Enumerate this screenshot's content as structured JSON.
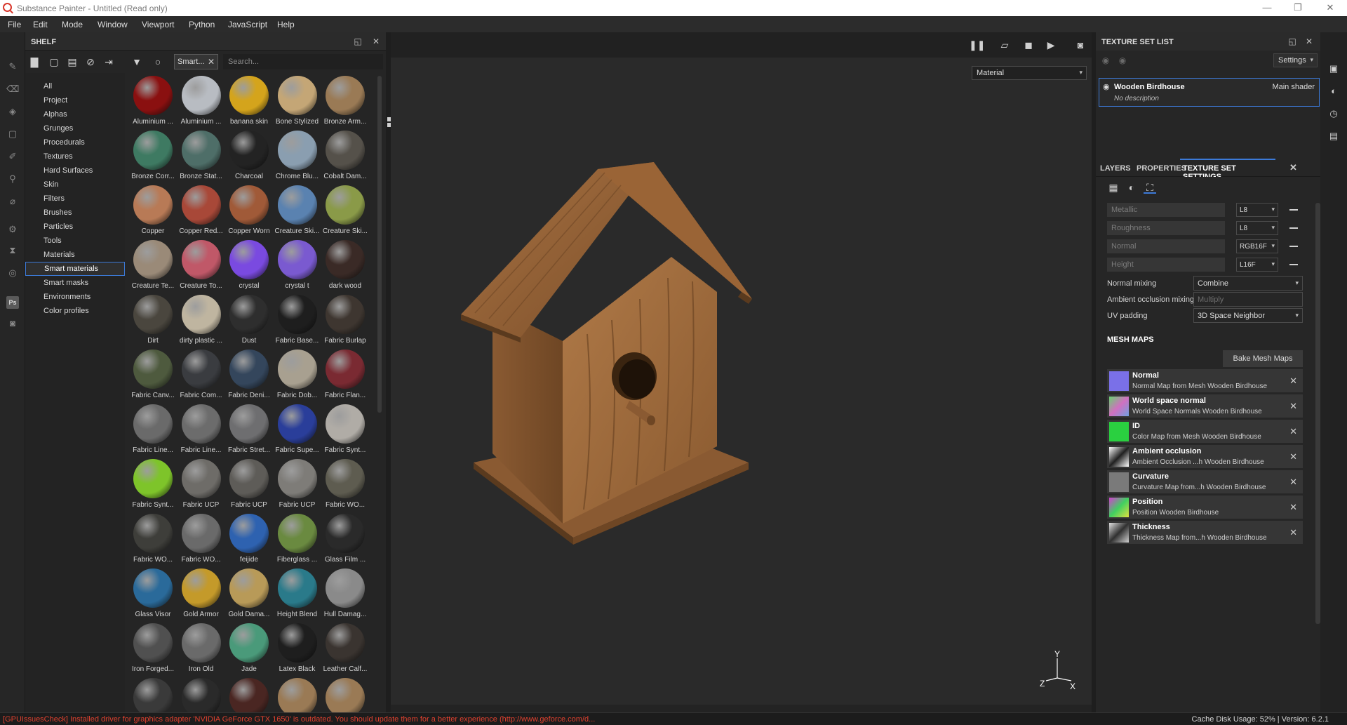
{
  "window": {
    "title": "Substance Painter - Untitled (Read only)"
  },
  "menu": [
    "File",
    "Edit",
    "Mode",
    "Window",
    "Viewport",
    "Python",
    "JavaScript",
    "Help"
  ],
  "shelf": {
    "title": "SHELF",
    "filter_chip": "Smart...",
    "search_placeholder": "Search...",
    "categories": [
      "All",
      "Project",
      "Alphas",
      "Grunges",
      "Procedurals",
      "Textures",
      "Hard Surfaces",
      "Skin",
      "Filters",
      "Brushes",
      "Particles",
      "Tools",
      "Materials",
      "Smart materials",
      "Smart masks",
      "Environments",
      "Color profiles"
    ],
    "active_category": "Smart materials",
    "materials": [
      {
        "label": "Aluminium ...",
        "color": "#8a1010"
      },
      {
        "label": "Aluminium ...",
        "color": "#b8bcc2"
      },
      {
        "label": "banana skin",
        "color": "#d4a41c"
      },
      {
        "label": "Bone Stylized",
        "color": "#c4a676"
      },
      {
        "label": "Bronze Arm...",
        "color": "#9a7a55"
      },
      {
        "label": "Bronze Corr...",
        "color": "#3e7a62"
      },
      {
        "label": "Bronze Stat...",
        "color": "#4e6e68"
      },
      {
        "label": "Charcoal",
        "color": "#232323"
      },
      {
        "label": "Chrome Blu...",
        "color": "#8a9eb0"
      },
      {
        "label": "Cobalt Dam...",
        "color": "#55514a"
      },
      {
        "label": "Copper",
        "color": "#b87a56"
      },
      {
        "label": "Copper Red...",
        "color": "#a84838"
      },
      {
        "label": "Copper Worn",
        "color": "#a05a38"
      },
      {
        "label": "Creature Ski...",
        "color": "#5a82b0"
      },
      {
        "label": "Creature Ski...",
        "color": "#8a9a48"
      },
      {
        "label": "Creature Te...",
        "color": "#9a8a78"
      },
      {
        "label": "Creature To...",
        "color": "#c05868"
      },
      {
        "label": "crystal",
        "color": "#7a4ae0"
      },
      {
        "label": "crystal t",
        "color": "#7a5ad0"
      },
      {
        "label": "dark wood",
        "color": "#3a2a26"
      },
      {
        "label": "Dirt",
        "color": "#4a463e"
      },
      {
        "label": "dirty plastic ...",
        "color": "#bfb5a0"
      },
      {
        "label": "Dust",
        "color": "#2e2e2e"
      },
      {
        "label": "Fabric Base...",
        "color": "#1e1e1e"
      },
      {
        "label": "Fabric Burlap",
        "color": "#3e3630"
      },
      {
        "label": "Fabric Canv...",
        "color": "#4e5a3e"
      },
      {
        "label": "Fabric Com...",
        "color": "#3a3c40"
      },
      {
        "label": "Fabric Deni...",
        "color": "#34465c"
      },
      {
        "label": "Fabric Dob...",
        "color": "#a8a090"
      },
      {
        "label": "Fabric Flan...",
        "color": "#7a2a32"
      },
      {
        "label": "Fabric Line...",
        "color": "#6a6a6a"
      },
      {
        "label": "Fabric Line...",
        "color": "#6c6c6c"
      },
      {
        "label": "Fabric Stret...",
        "color": "#6e6e70"
      },
      {
        "label": "Fabric Supe...",
        "color": "#2a3e9a"
      },
      {
        "label": "Fabric Synt...",
        "color": "#b0aca6"
      },
      {
        "label": "Fabric Synt...",
        "color": "#7ec42a"
      },
      {
        "label": "Fabric UCP",
        "color": "#6e6c68"
      },
      {
        "label": "Fabric UCP",
        "color": "#5e5c58"
      },
      {
        "label": "Fabric UCP",
        "color": "#7e7c78"
      },
      {
        "label": "Fabric WO...",
        "color": "#5e5c50"
      },
      {
        "label": "Fabric WO...",
        "color": "#3e3e3a"
      },
      {
        "label": "Fabric WO...",
        "color": "#6a6a6a"
      },
      {
        "label": "feijide",
        "color": "#2e62b0"
      },
      {
        "label": "Fiberglass ...",
        "color": "#6a8a40"
      },
      {
        "label": "Glass Film ...",
        "color": "#2a2a2a"
      },
      {
        "label": "Glass Visor",
        "color": "#2a6a9a"
      },
      {
        "label": "Gold Armor",
        "color": "#c49a2a"
      },
      {
        "label": "Gold Dama...",
        "color": "#b89a58"
      },
      {
        "label": "Height Blend",
        "color": "#2a7a8a"
      },
      {
        "label": "Hull Damag...",
        "color": "#8a8a8a"
      },
      {
        "label": "Iron Forged...",
        "color": "#505050"
      },
      {
        "label": "Iron Old",
        "color": "#6a6a6a"
      },
      {
        "label": "Jade",
        "color": "#4a9a7a"
      },
      {
        "label": "Latex Black",
        "color": "#1e1e1e"
      },
      {
        "label": "Leather Calf...",
        "color": "#3a3430"
      },
      {
        "label": "",
        "color": "#3a3a3a"
      },
      {
        "label": "",
        "color": "#2a2a2a"
      },
      {
        "label": "",
        "color": "#4a2622"
      },
      {
        "label": "",
        "color": "#9a7a55"
      },
      {
        "label": "",
        "color": "#9a7a55"
      }
    ]
  },
  "viewport": {
    "mode_select": "Material",
    "gizmo": {
      "y": "Y",
      "z": "Z",
      "x": "X"
    }
  },
  "texture_set_list": {
    "title": "TEXTURE SET LIST",
    "settings_label": "Settings",
    "item": {
      "name": "Wooden Birdhouse",
      "shader": "Main shader",
      "description": "No description"
    }
  },
  "tabs": {
    "layers": "LAYERS",
    "properties": "PROPERTIES",
    "texture_set_settings": "TEXTURE SET SETTINGS"
  },
  "texture_set_settings": {
    "channels": [
      {
        "name": "Metallic",
        "format": "L8"
      },
      {
        "name": "Roughness",
        "format": "L8"
      },
      {
        "name": "Normal",
        "format": "RGB16F"
      },
      {
        "name": "Height",
        "format": "L16F"
      }
    ],
    "normal_mixing": {
      "label": "Normal mixing",
      "value": "Combine"
    },
    "ao_mixing": {
      "label": "Ambient occlusion mixing",
      "value": "Multiply"
    },
    "uv_padding": {
      "label": "UV padding",
      "value": "3D Space Neighbor"
    },
    "mesh_maps_title": "MESH MAPS",
    "bake_button": "Bake Mesh Maps",
    "mesh_maps": [
      {
        "name": "Normal",
        "desc": "Normal Map from Mesh Wooden Birdhouse"
      },
      {
        "name": "World space normal",
        "desc": "World Space Normals Wooden Birdhouse"
      },
      {
        "name": "ID",
        "desc": "Color Map from Mesh Wooden Birdhouse"
      },
      {
        "name": "Ambient occlusion",
        "desc": "Ambient Occlusion ...h Wooden Birdhouse"
      },
      {
        "name": "Curvature",
        "desc": "Curvature Map from...h Wooden Birdhouse"
      },
      {
        "name": "Position",
        "desc": "Position Wooden Birdhouse"
      },
      {
        "name": "Thickness",
        "desc": "Thickness Map from...h Wooden Birdhouse"
      }
    ]
  },
  "statusbar": {
    "warning": "[GPUIssuesCheck] Installed driver for graphics adapter 'NVIDIA GeForce GTX 1650' is outdated. You should update them for a better experience (http://www.geforce.com/d...",
    "cache": "Cache Disk Usage:   52% | Version: 6.2.1"
  },
  "colors": {
    "accent": "#3c7ad8",
    "warning": "#e0412f",
    "wood": "#a0683a"
  }
}
